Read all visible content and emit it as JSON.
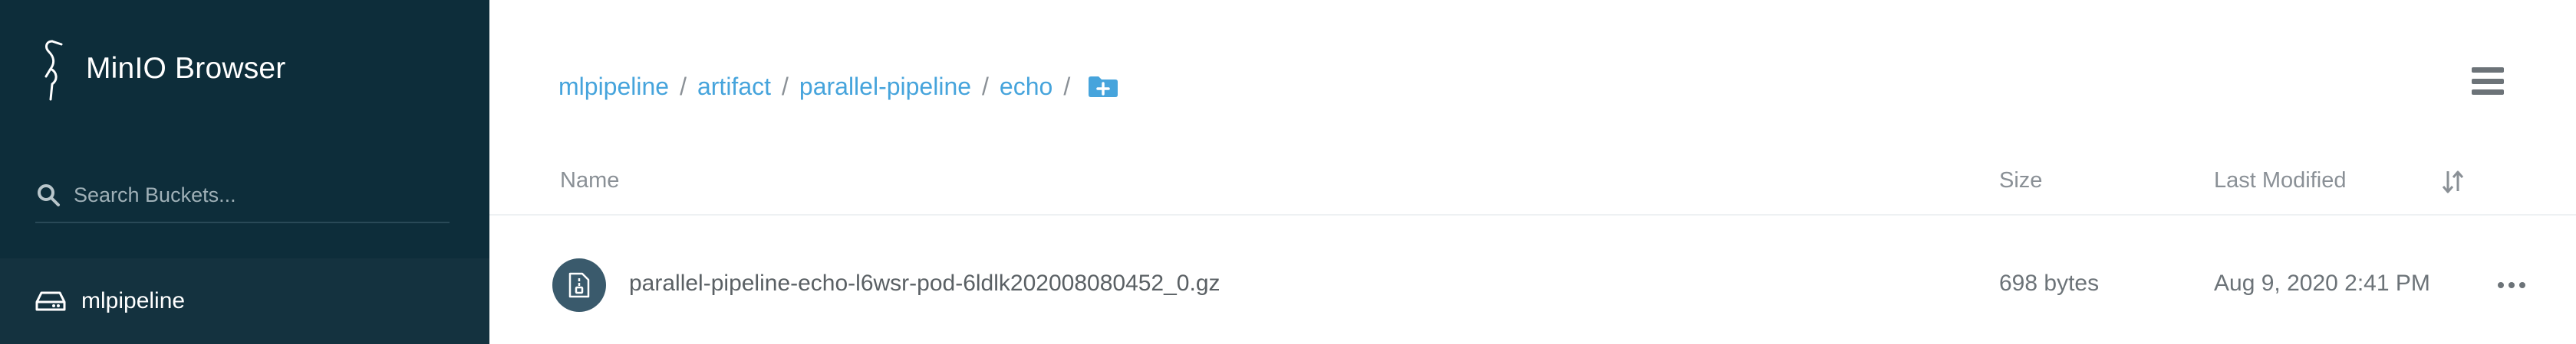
{
  "app": {
    "title": "MinIO Browser"
  },
  "sidebar": {
    "search": {
      "placeholder": "Search Buckets..."
    },
    "buckets": [
      {
        "label": "mlpipeline"
      }
    ]
  },
  "breadcrumb": {
    "items": [
      {
        "label": "mlpipeline"
      },
      {
        "label": "artifact"
      },
      {
        "label": "parallel-pipeline"
      },
      {
        "label": "echo"
      }
    ],
    "separator": "/"
  },
  "table": {
    "columns": {
      "name": "Name",
      "size": "Size",
      "last_modified": "Last Modified"
    },
    "rows": [
      {
        "name": "parallel-pipeline-echo-l6wsr-pod-6ldlk202008080452_0.gz",
        "size": "698 bytes",
        "last_modified": "Aug 9, 2020 2:41 PM"
      }
    ]
  },
  "colors": {
    "sidebar_bg": "#0d2d3a",
    "sidebar_active": "#14323f",
    "accent": "#46a4dc",
    "file_icon_bg": "#3a5a6c"
  },
  "icons": {
    "logo": "minio-heron-icon",
    "search": "search-icon",
    "bucket": "drive-icon",
    "add_folder": "folder-plus-icon",
    "menu": "hamburger-menu-icon",
    "sort": "sort-icon",
    "file": "file-archive-icon",
    "more": "more-horizontal-icon"
  }
}
